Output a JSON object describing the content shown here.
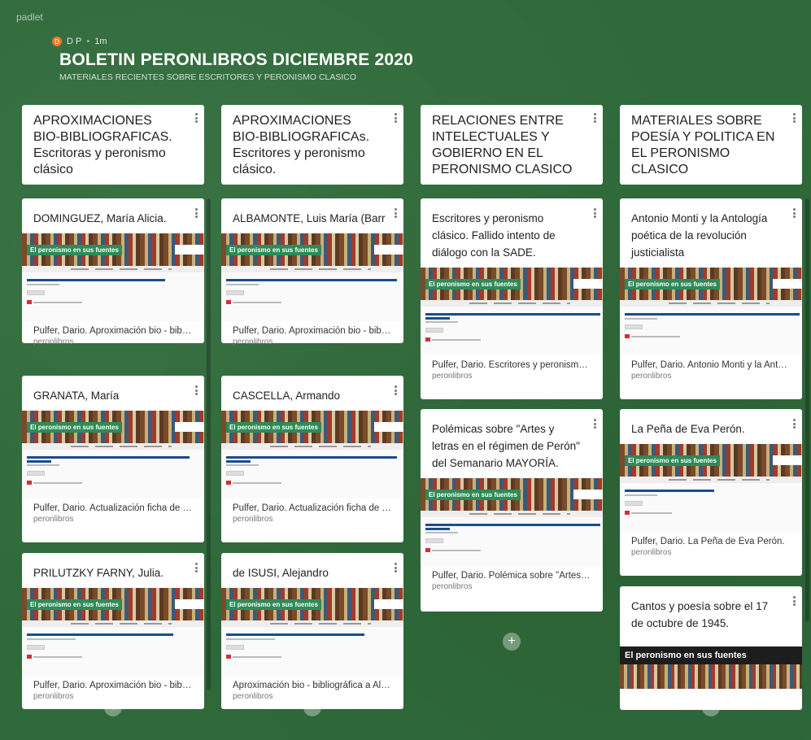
{
  "app": {
    "brand": "padlet"
  },
  "header": {
    "avatar_initial": "D",
    "author": "D P",
    "time": "1m",
    "title": "BOLETIN PERONLIBROS DICIEMBRE 2020",
    "subtitle": "MATERIALES RECIENTES SOBRE ESCRITORES Y PERONISMO CLASICO"
  },
  "preview": {
    "tag": "El peronismo en sus fuentes"
  },
  "columns": [
    {
      "title": "APROXIMACIONES BIO-BIBLIOGRAFICAS. Escritoras y peronismo clásico",
      "cards": [
        {
          "title": "DOMINGUEZ, María Alicia.",
          "caption": "Pulfer, Dario. Aproximación bio - bibliogr...",
          "source": "peronlibros"
        },
        {
          "title": "GRANATA, María",
          "caption": "Pulfer, Dario. Actualización ficha de trab...",
          "source": "peronlibros"
        },
        {
          "title": "PRILUTZKY FARNY, Julia.",
          "caption": "Pulfer, Dario. Aproximación bio - bibliogr...",
          "source": "peronlibros"
        }
      ]
    },
    {
      "title": "APROXIMACIONES BIO-BIBLIOGRAFICAs. Escritores y peronismo clásico.",
      "cards": [
        {
          "title": "ALBAMONTE, Luis María (Barr",
          "caption": "Pulfer, Dario. Aproximación bio - bibliogr...",
          "source": "peronlibros"
        },
        {
          "title": "CASCELLA, Armando",
          "caption": "Pulfer, Dario. Actualización ficha de trab...",
          "source": "peronlibros"
        },
        {
          "title": "de ISUSI, Alejandro",
          "caption": "Aproximación bio - bibliográfica a Alejan...",
          "source": "peronlibros"
        }
      ]
    },
    {
      "title": "RELACIONES ENTRE INTELECTUALES Y GOBIERNO EN EL PERONISMO CLASICO",
      "cards": [
        {
          "title": "Escritores y peronismo clásico. Fallido intento de diálogo con la SADE.",
          "caption": "Pulfer, Dario. Escritores y peronismo clá...",
          "source": "peronlibros"
        },
        {
          "title": "Polémicas sobre \"Artes y letras en el régimen de Perón\" del Semanario MAYORÍA.",
          "caption": "Pulfer, Dario. Polémica sobre \"Artes y let...",
          "source": "peronlibros"
        }
      ]
    },
    {
      "title": "MATERIALES SOBRE POESÍA Y POLITICA EN EL PERONISMO CLASICO",
      "cards": [
        {
          "title": "Antonio Monti y la Antología poética de la revolución justicialista",
          "caption": "Pulfer, Dario. Antonio Monti y la Antologí...",
          "source": "peronlibros"
        },
        {
          "title": "La Peña de Eva Perón.",
          "caption": "Pulfer, Dario. La Peña de Eva Perón.",
          "source": "peronlibros"
        },
        {
          "title": "Cantos y poesía sobre el 17 de octubre de 1945.",
          "caption": "",
          "source": ""
        }
      ]
    }
  ]
}
